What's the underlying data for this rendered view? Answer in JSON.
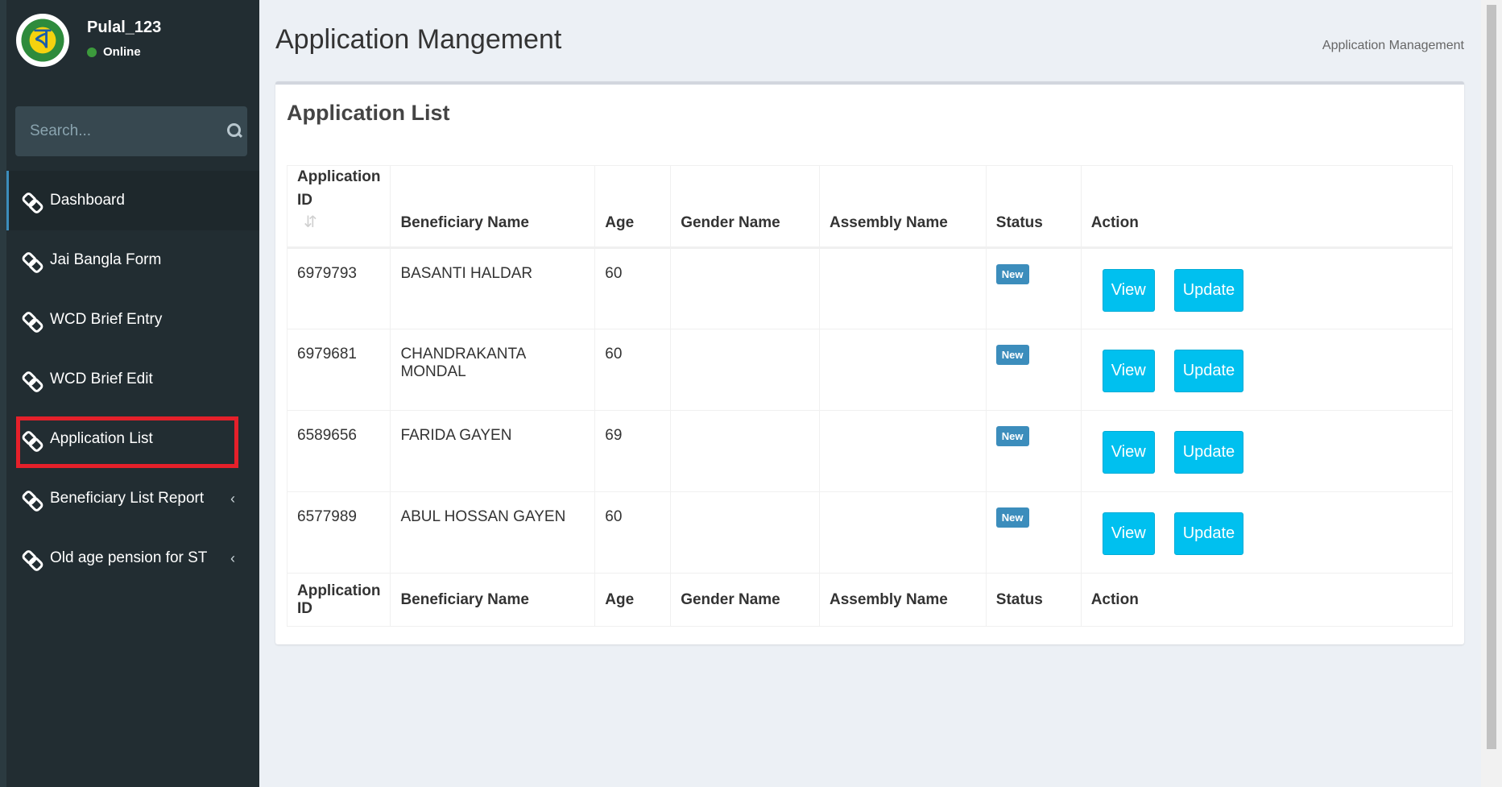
{
  "user": {
    "name": "Pulal_123",
    "status": "Online"
  },
  "search": {
    "placeholder": "Search..."
  },
  "sidebar": {
    "items": [
      {
        "label": "Dashboard"
      },
      {
        "label": "Jai Bangla Form"
      },
      {
        "label": "WCD Brief Entry"
      },
      {
        "label": "WCD Brief Edit"
      },
      {
        "label": "Application List"
      },
      {
        "label": "Beneficiary List Report"
      },
      {
        "label": "Old age pension for ST"
      }
    ]
  },
  "header": {
    "title": "Application Mangement",
    "breadcrumb": "Application Management"
  },
  "box": {
    "title": "Application List"
  },
  "table": {
    "headers": [
      "Application ID",
      "Beneficiary Name",
      "Age",
      "Gender Name",
      "Assembly Name",
      "Status",
      "Action"
    ],
    "rows": [
      {
        "id": "6979793",
        "name": "BASANTI HALDAR",
        "age": "60",
        "gender": "",
        "assembly": "",
        "status": "New"
      },
      {
        "id": "6979681",
        "name": "CHANDRAKANTA MONDAL",
        "age": "60",
        "gender": "",
        "assembly": "",
        "status": "New"
      },
      {
        "id": "6589656",
        "name": "FARIDA GAYEN",
        "age": "69",
        "gender": "",
        "assembly": "",
        "status": "New"
      },
      {
        "id": "6577989",
        "name": "ABUL HOSSAN GAYEN",
        "age": "60",
        "gender": "",
        "assembly": "",
        "status": "New"
      }
    ],
    "view_label": "View",
    "update_label": "Update",
    "footers": [
      "Application ID",
      "Beneficiary Name",
      "Age",
      "Gender Name",
      "Assembly Name",
      "Status",
      "Action"
    ]
  },
  "colors": {
    "sidebar_bg": "#222d32",
    "accent": "#00c0ef",
    "badge": "#3c8dbc",
    "highlight_box": "#e5202a"
  },
  "icons": {
    "search": "search-icon",
    "menu": "link-icon",
    "sort": "sort-icon",
    "chevron": "chevron-left-icon"
  }
}
